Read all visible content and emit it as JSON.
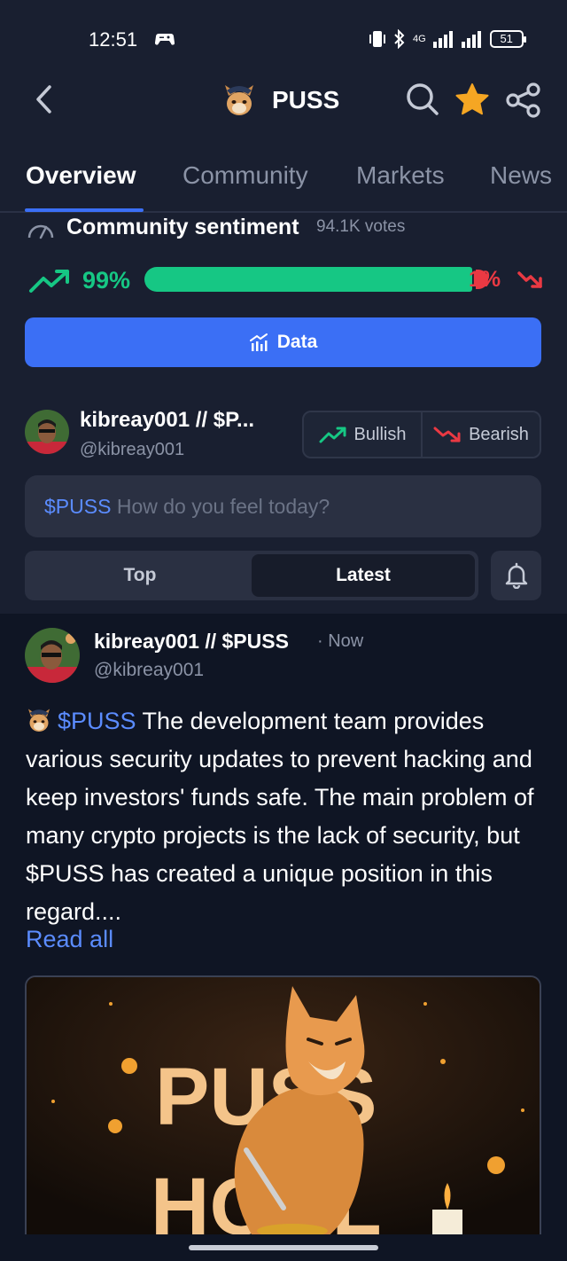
{
  "status_bar": {
    "time": "12:51",
    "network": "4G",
    "battery": "51"
  },
  "header": {
    "title": "PUSS"
  },
  "tabs": [
    "Overview",
    "Community",
    "Markets",
    "News"
  ],
  "sentiment": {
    "title": "Community sentiment",
    "votes": "94.1K votes",
    "bullish_pct": "99%",
    "bearish_pct": "1%",
    "bullish_fraction": 0.99,
    "bullish_color": "#16c784",
    "bearish_color": "#ea3943"
  },
  "data_button": {
    "label": "Data"
  },
  "composer": {
    "name": "kibreay001 // $P...",
    "handle": "@kibreay001",
    "bullish_label": "Bullish",
    "bearish_label": "Bearish",
    "input_ticker": "$PUSS",
    "input_placeholder": "How do you feel today?"
  },
  "sort": {
    "top_label": "Top",
    "latest_label": "Latest",
    "selected": "Latest"
  },
  "post": {
    "author": "kibreay001 // $PUSS",
    "time": "· Now",
    "handle": "@kibreay001",
    "ticker": "$PUSS",
    "text": " The development team provides various security updates to prevent hacking and keep investors' funds safe. The main problem of many crypto projects is the lack of security, but $PUSS has created a unique position in this regard....",
    "read_all": "Read all",
    "image_text_line1": "PUSS",
    "image_text_line2": "HODL"
  },
  "colors": {
    "accent": "#3b6ff5",
    "link": "#5b8cff",
    "star": "#f5a623"
  }
}
